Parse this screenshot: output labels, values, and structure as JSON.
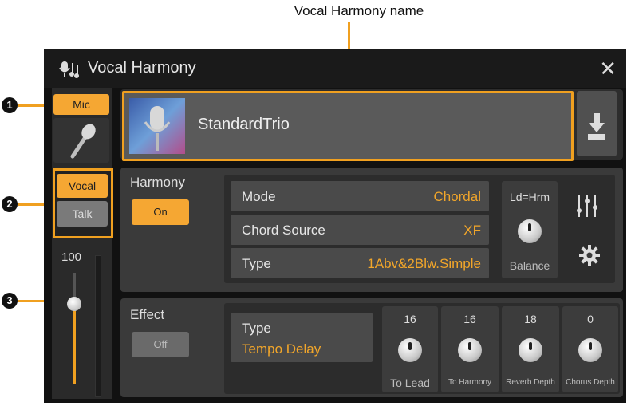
{
  "caption": "Vocal Harmony name",
  "callouts": [
    "1",
    "2",
    "3"
  ],
  "window": {
    "title": "Vocal Harmony",
    "close_icon": "close-icon"
  },
  "left": {
    "mic_label": "Mic",
    "vocal_label": "Vocal",
    "talk_label": "Talk",
    "level_value": "100",
    "level_fraction": 0.72
  },
  "preset": {
    "name": "StandardTrio",
    "save_icon": "save-download-icon"
  },
  "harmony": {
    "section_label": "Harmony",
    "on_label": "On",
    "rows": [
      {
        "label": "Mode",
        "value": "Chordal"
      },
      {
        "label": "Chord Source",
        "value": "XF"
      },
      {
        "label": "Type",
        "value": "1Abv&2Blw.Simple"
      }
    ],
    "balance_top": "Ld=Hrm",
    "balance_label": "Balance"
  },
  "effect": {
    "section_label": "Effect",
    "off_label": "Off",
    "type_label": "Type",
    "type_value": "Tempo Delay",
    "knobs": [
      {
        "value": "16",
        "label": "To Lead"
      },
      {
        "value": "16",
        "label": "To Harmony"
      },
      {
        "value": "18",
        "label": "Reverb Depth"
      },
      {
        "value": "0",
        "label": "Chorus Depth"
      }
    ]
  },
  "colors": {
    "accent": "#f2a62a",
    "highlight": "#f0a020",
    "on_button": "#f5a733"
  }
}
